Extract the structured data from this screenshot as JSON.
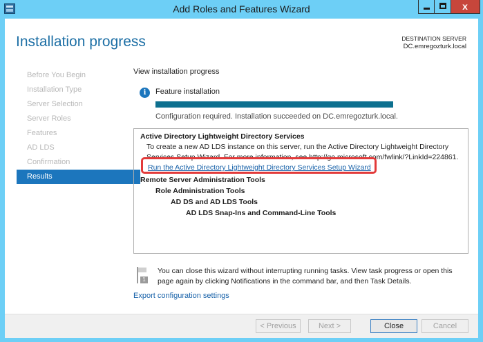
{
  "window": {
    "title": "Add Roles and Features Wizard",
    "close_glyph": "x",
    "icons": {
      "app": "server-manager-icon",
      "min": "minimize-icon",
      "max": "maximize-icon",
      "close": "close-icon"
    }
  },
  "header": {
    "page_title": "Installation progress",
    "destination_label": "DESTINATION SERVER",
    "destination_value": "DC.emregozturk.local"
  },
  "nav": {
    "items": [
      {
        "label": "Before You Begin"
      },
      {
        "label": "Installation Type"
      },
      {
        "label": "Server Selection"
      },
      {
        "label": "Server Roles"
      },
      {
        "label": "Features"
      },
      {
        "label": "AD LDS"
      },
      {
        "label": "Confirmation"
      },
      {
        "label": "Results"
      }
    ],
    "active": "Results"
  },
  "content": {
    "section_label": "View installation progress",
    "feature_title": "Feature installation",
    "progress": 1.0,
    "status": "Configuration required. Installation succeeded on DC.emregozturk.local.",
    "info_glyph": "i"
  },
  "results": {
    "lines": [
      "Active Directory Lightweight Directory Services",
      "To create a new AD LDS instance on this server, run the Active Directory Lightweight Directory",
      "Services Setup Wizard. For more information, see http://go.microsoft.com/fwlink/?LinkId=224861.",
      "Run the Active Directory Lightweight Directory Services Setup Wizard",
      "Remote Server Administration Tools",
      "Role Administration Tools",
      "AD DS and AD LDS Tools",
      "AD LDS Snap-Ins and Command-Line Tools"
    ]
  },
  "notice": {
    "text": "You can close this wizard without interrupting running tasks. View task progress or open this page again by clicking Notifications in the command bar, and then Task Details.",
    "badge": "1"
  },
  "export_link": "Export configuration settings",
  "buttons": {
    "previous": "< Previous",
    "next": "Next >",
    "close": "Close",
    "cancel": "Cancel"
  },
  "colors": {
    "accent": "#1c76bd",
    "progress": "#0d708f",
    "highlight": "#e23a3a",
    "frame": "#6dcff6"
  }
}
